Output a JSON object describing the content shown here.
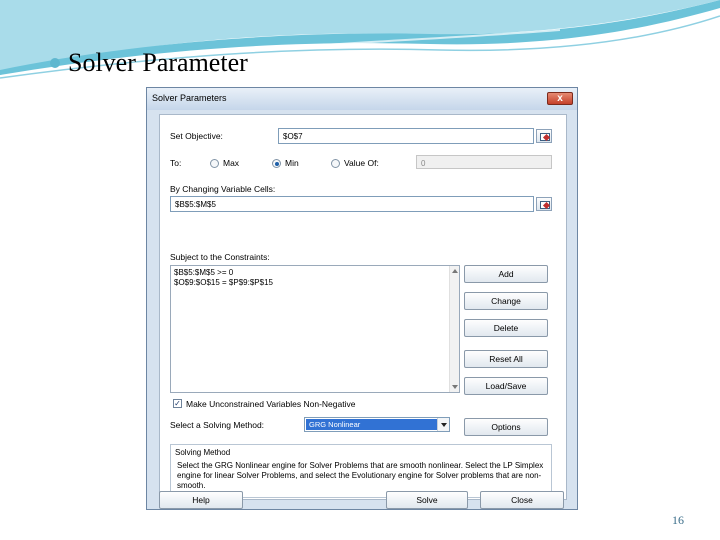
{
  "slide": {
    "title": "Solver Parameter",
    "page_number": "16"
  },
  "dialog": {
    "title": "Solver Parameters",
    "close_glyph": "x",
    "set_objective_label": "Set Objective:",
    "set_objective_value": "$O$7",
    "to_label": "To:",
    "radio_max_label": "Max",
    "radio_min_label": "Min",
    "radio_value_label": "Value Of:",
    "radio_selected": "Min",
    "value_of_input": "0",
    "changing_cells_label": "By Changing Variable Cells:",
    "changing_cells_value": "$B$5:$M$5",
    "constraints_label": "Subject to the Constraints:",
    "constraints": [
      "$B$5:$M$5 >= 0",
      "$O$9:$O$15 = $P$9:$P$15"
    ],
    "buttons": {
      "add": "Add",
      "change": "Change",
      "delete": "Delete",
      "reset_all": "Reset All",
      "load_save": "Load/Save",
      "options": "Options",
      "help": "Help",
      "solve": "Solve",
      "close": "Close"
    },
    "nonnegative_label": "Make Unconstrained Variables Non-Negative",
    "nonnegative_checked": true,
    "method_label": "Select a Solving Method:",
    "method_value": "GRG Nonlinear",
    "solving_method_title": "Solving Method",
    "solving_method_text": "Select the GRG Nonlinear engine for Solver Problems that are smooth nonlinear. Select the LP Simplex engine for linear Solver Problems, and select the Evolutionary engine for Solver problems that are non-smooth."
  },
  "colors": {
    "accent": "#5fb7cf",
    "dialog_background": "#d6e2ef",
    "selection": "#3172d4"
  }
}
